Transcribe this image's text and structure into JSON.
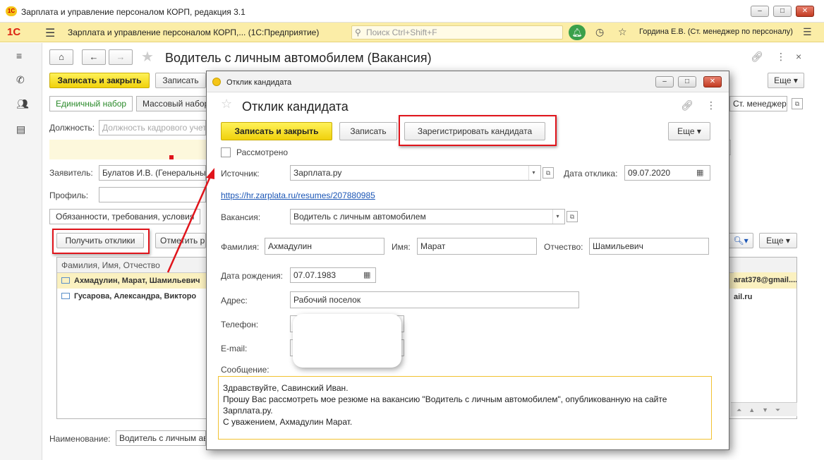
{
  "window": {
    "title": "Зарплата и управление персоналом КОРП, редакция 3.1",
    "logo": "1С",
    "controls": [
      "minimize",
      "maximize",
      "close"
    ]
  },
  "appbar": {
    "brand": "1С",
    "title": "Зарплата и управление персоналом КОРП,...  (1С:Предприятие)",
    "search_placeholder": "Поиск Ctrl+Shift+F",
    "user": "Гордина Е.В. (Ст. менеджер по персоналу)",
    "icons": [
      "menu-icon",
      "search-icon",
      "bell-icon",
      "history-icon",
      "star-icon",
      "more-icon"
    ]
  },
  "leftnav": {
    "icons": [
      "menu-lines-icon",
      "phone-icon",
      "people-icon",
      "id-card-icon"
    ]
  },
  "main": {
    "title": "Водитель с личным автомобилем (Вакансия)",
    "save_close": "Записать и закрыть",
    "save": "Записать",
    "more": "Еще",
    "tabs_top": [
      "Единичный набор",
      "Массовый набор"
    ],
    "manager_field": "Ст. менеджер п",
    "position_label": "Должность:",
    "position_placeholder": "Должность кадрового учета",
    "applicant_label": "Заявитель:",
    "applicant_value": "Булатов И.В. (Генеральный",
    "profile_label": "Профиль:",
    "tab_duties": "Обязанности, требования, условия",
    "get_responses": "Получить отклики",
    "mark": "Отметить р",
    "grid_header": "Фамилия, Имя, Отчество",
    "rows": [
      {
        "name": "Ахмадулин, Марат, Шамильевич",
        "email": "arat378@gmail...."
      },
      {
        "name": "Гусарова, Александра, Викторо",
        "email": "ail.ru"
      }
    ],
    "name_label": "Наименование:",
    "name_value": "Водитель с личным ав"
  },
  "dialog": {
    "window_title": "Отклик кандидата",
    "title": "Отклик кандидата",
    "save_close": "Записать и закрыть",
    "save": "Записать",
    "register": "Зарегистрировать кандидата",
    "more": "Еще",
    "reviewed_label": "Рассмотрено",
    "source_label": "Источник:",
    "source_value": "Зарплата.ру",
    "date_label": "Дата отклика:",
    "date_value": "09.07.2020",
    "resume_link": "https://hr.zarplata.ru/resumes/207880985",
    "vacancy_label": "Вакансия:",
    "vacancy_value": "Водитель с личным автомобилем",
    "lastname_label": "Фамилия:",
    "lastname_value": "Ахмадулин",
    "firstname_label": "Имя:",
    "firstname_value": "Марат",
    "middlename_label": "Отчество:",
    "middlename_value": "Шамильевич",
    "birth_label": "Дата рождения:",
    "birth_value": "07.07.1983",
    "address_label": "Адрес:",
    "address_value": "Рабочий поселок",
    "phone_label": "Телефон:",
    "email_label": "E-mail:",
    "message_label": "Сообщение:",
    "message_lines": [
      "Здравствуйте, Савинский Иван.",
      "Прошу Вас рассмотреть мое резюме на вакансию \"Водитель с личным автомобилем\", опубликованную на сайте",
      "Зарплата.ру.",
      "С уважением, Ахмадулин Марат."
    ]
  },
  "colors": {
    "accent_yellow": "#f0d10c",
    "highlight_red": "#e0141b",
    "appbar": "#fbeda7",
    "link": "#1a55b5"
  }
}
